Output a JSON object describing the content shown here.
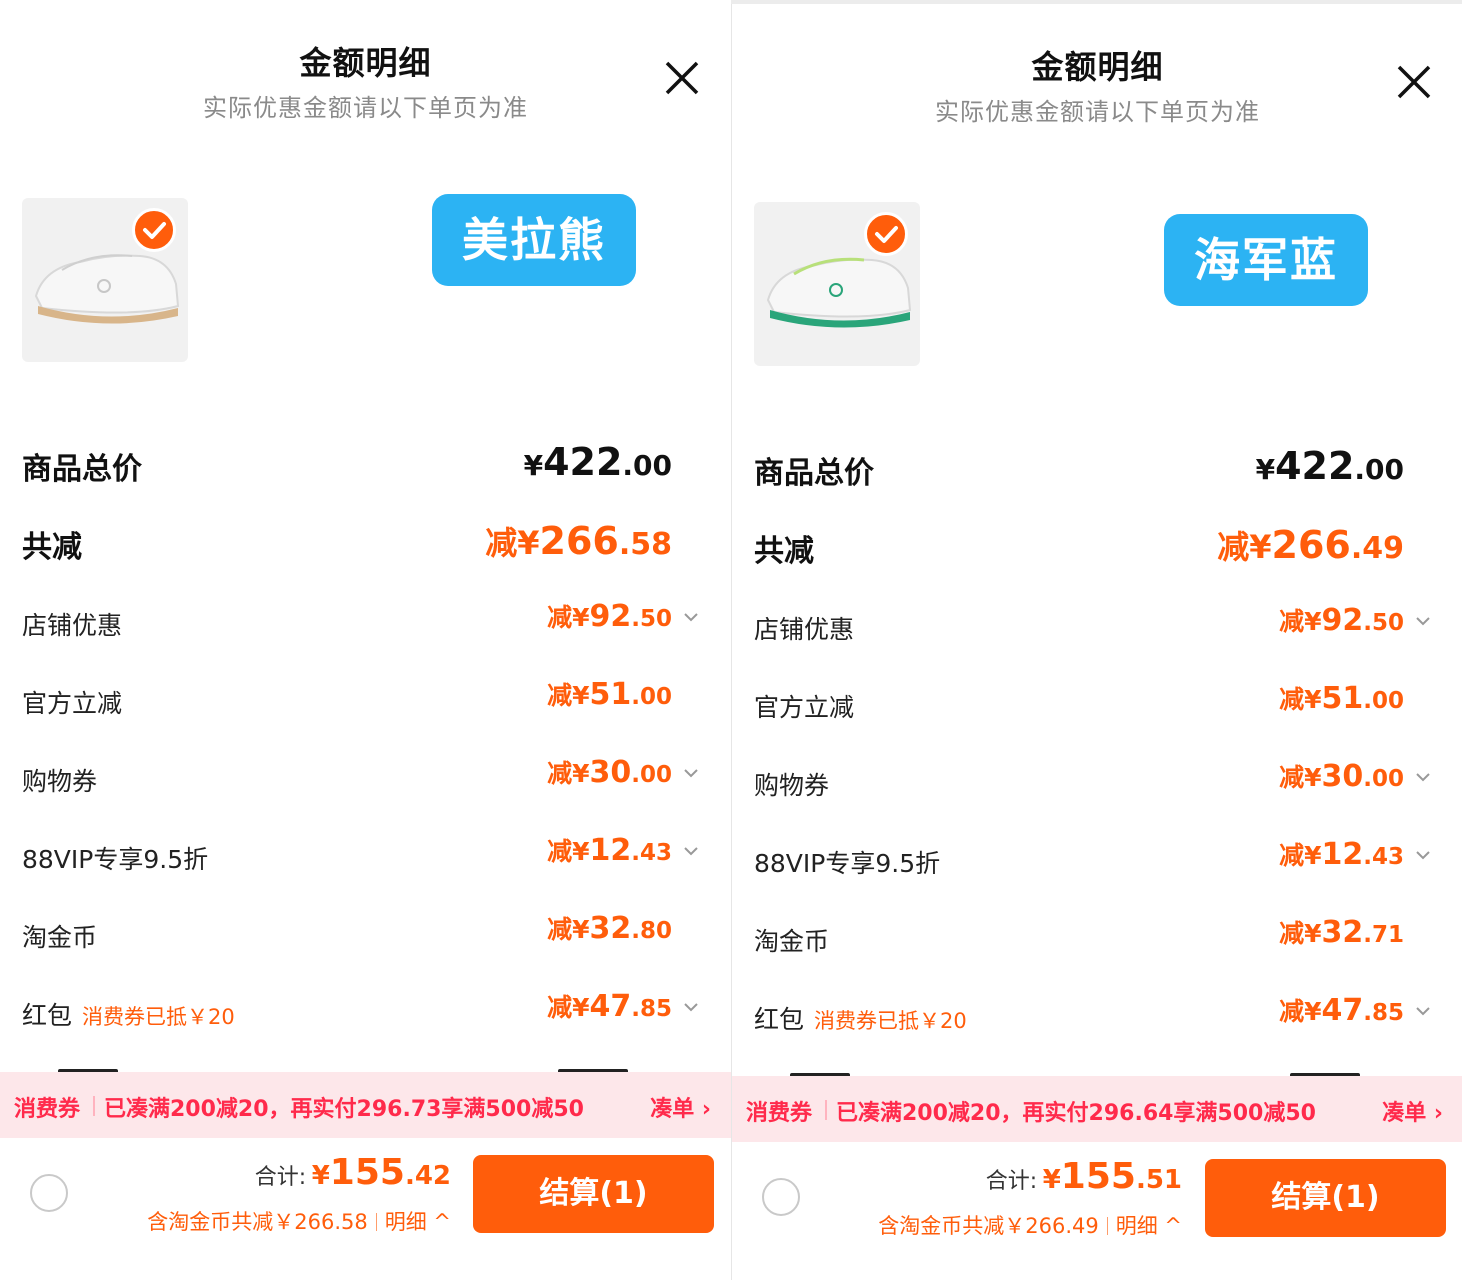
{
  "colors": {
    "accent": "#ff5d0b",
    "coupon": "#ff2a4b",
    "variant_badge": "#2cb3f3"
  },
  "panels": [
    {
      "title": "金额明细",
      "subtitle": "实际优惠金额请以下单页为准",
      "variant_label": "美拉熊",
      "product_thumbnail": "white-sneaker-with-gum-sole",
      "total_price": {
        "label": "商品总价",
        "prefix": "¥",
        "int": "422",
        "dec": ".00"
      },
      "total_reduction": {
        "label": "共减",
        "prefix": "减¥",
        "int": "266",
        "dec": ".58"
      },
      "discounts": [
        {
          "label": "店铺优惠",
          "note": "",
          "prefix": "减¥",
          "int": "92",
          "dec": ".50",
          "expandable": true
        },
        {
          "label": "官方立减",
          "note": "",
          "prefix": "减¥",
          "int": "51",
          "dec": ".00",
          "expandable": false
        },
        {
          "label": "购物券",
          "note": "",
          "prefix": "减¥",
          "int": "30",
          "dec": ".00",
          "expandable": true
        },
        {
          "label": "88VIP专享9.5折",
          "note": "",
          "prefix": "减¥",
          "int": "12",
          "dec": ".43",
          "expandable": true
        },
        {
          "label": "淘金币",
          "note": "",
          "prefix": "减¥",
          "int": "32",
          "dec": ".80",
          "expandable": false
        },
        {
          "label": "红包",
          "note": "消费券已抵￥20",
          "prefix": "减¥",
          "int": "47",
          "dec": ".85",
          "expandable": true
        }
      ],
      "banner": {
        "tag": "消费券",
        "message": "已凑满200减20，再实付296.73享满500减50",
        "link": "凑单 ›"
      },
      "footer": {
        "sum_label": "合计:",
        "sum_prefix": "¥",
        "sum_int": "155",
        "sum_dec": ".42",
        "sub_text": "含淘金币共减￥266.58",
        "detail_link": "明细 ^",
        "checkout_label": "结算(1)"
      }
    },
    {
      "title": "金额明细",
      "subtitle": "实际优惠金额请以下单页为准",
      "variant_label": "海军蓝",
      "product_thumbnail": "white-sneaker-with-green-sole",
      "total_price": {
        "label": "商品总价",
        "prefix": "¥",
        "int": "422",
        "dec": ".00"
      },
      "total_reduction": {
        "label": "共减",
        "prefix": "减¥",
        "int": "266",
        "dec": ".49"
      },
      "discounts": [
        {
          "label": "店铺优惠",
          "note": "",
          "prefix": "减¥",
          "int": "92",
          "dec": ".50",
          "expandable": true
        },
        {
          "label": "官方立减",
          "note": "",
          "prefix": "减¥",
          "int": "51",
          "dec": ".00",
          "expandable": false
        },
        {
          "label": "购物券",
          "note": "",
          "prefix": "减¥",
          "int": "30",
          "dec": ".00",
          "expandable": true
        },
        {
          "label": "88VIP专享9.5折",
          "note": "",
          "prefix": "减¥",
          "int": "12",
          "dec": ".43",
          "expandable": true
        },
        {
          "label": "淘金币",
          "note": "",
          "prefix": "减¥",
          "int": "32",
          "dec": ".71",
          "expandable": false
        },
        {
          "label": "红包",
          "note": "消费券已抵￥20",
          "prefix": "减¥",
          "int": "47",
          "dec": ".85",
          "expandable": true
        }
      ],
      "banner": {
        "tag": "消费券",
        "message": "已凑满200减20，再实付296.64享满500减50",
        "link": "凑单 ›"
      },
      "footer": {
        "sum_label": "合计:",
        "sum_prefix": "¥",
        "sum_int": "155",
        "sum_dec": ".51",
        "sub_text": "含淘金币共减￥266.49",
        "detail_link": "明细 ^",
        "checkout_label": "结算(1)"
      }
    }
  ]
}
